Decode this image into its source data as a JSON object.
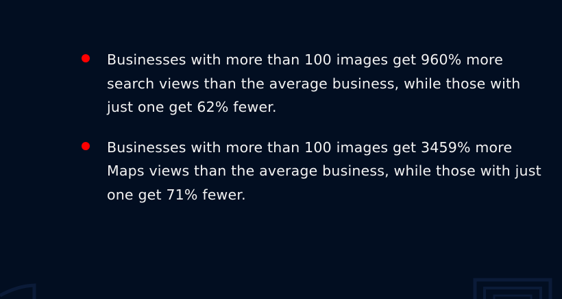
{
  "bullets": [
    {
      "text": "Businesses with more than 100 images get 960% more search views than the average business, while those with just one get 62% fewer."
    },
    {
      "text": "Businesses with more than 100 images get 3459% more Maps views than the average business, while those with just one get 71% fewer."
    }
  ],
  "colors": {
    "background": "#020e21",
    "bullet": "#ff0000",
    "text": "#f2f2f2",
    "decoration": "#0b1b38"
  }
}
